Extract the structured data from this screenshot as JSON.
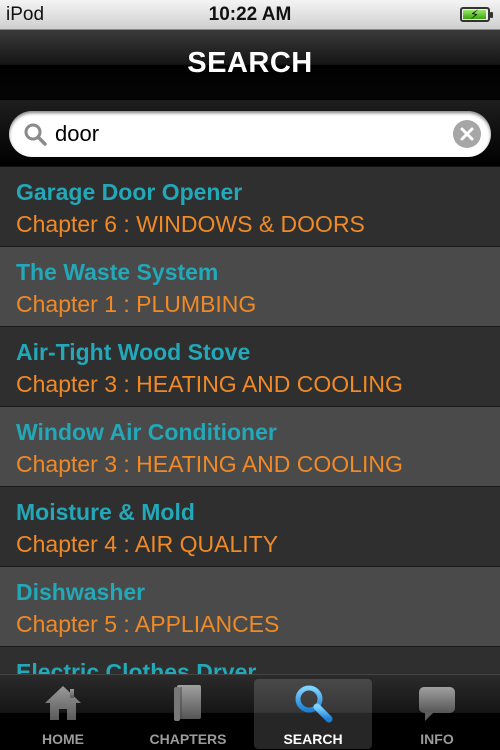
{
  "status_bar": {
    "device": "iPod",
    "time": "10:22 AM"
  },
  "nav": {
    "title": "SEARCH"
  },
  "search": {
    "value": "door",
    "placeholder": ""
  },
  "results": [
    {
      "title": "Garage Door Opener",
      "chapter": "Chapter 6 : WINDOWS & DOORS"
    },
    {
      "title": "The Waste System",
      "chapter": "Chapter 1 : PLUMBING"
    },
    {
      "title": "Air-Tight Wood Stove",
      "chapter": "Chapter 3 : HEATING AND COOLING"
    },
    {
      "title": "Window Air Conditioner",
      "chapter": "Chapter 3 : HEATING AND COOLING"
    },
    {
      "title": "Moisture & Mold",
      "chapter": "Chapter 4 : AIR QUALITY"
    },
    {
      "title": "Dishwasher",
      "chapter": "Chapter 5 : APPLIANCES"
    },
    {
      "title": "Electric Clothes Dryer",
      "chapter": ""
    }
  ],
  "tabs": [
    {
      "label": "HOME",
      "icon": "home-icon",
      "active": false
    },
    {
      "label": "CHAPTERS",
      "icon": "book-icon",
      "active": false
    },
    {
      "label": "SEARCH",
      "icon": "search-icon",
      "active": true
    },
    {
      "label": "INFO",
      "icon": "speech-bubble-icon",
      "active": false
    }
  ],
  "colors": {
    "title_teal": "#22a8b8",
    "chapter_orange": "#ef8a26",
    "row_dark": "#2f2f2f",
    "row_light": "#4a4a4a"
  }
}
